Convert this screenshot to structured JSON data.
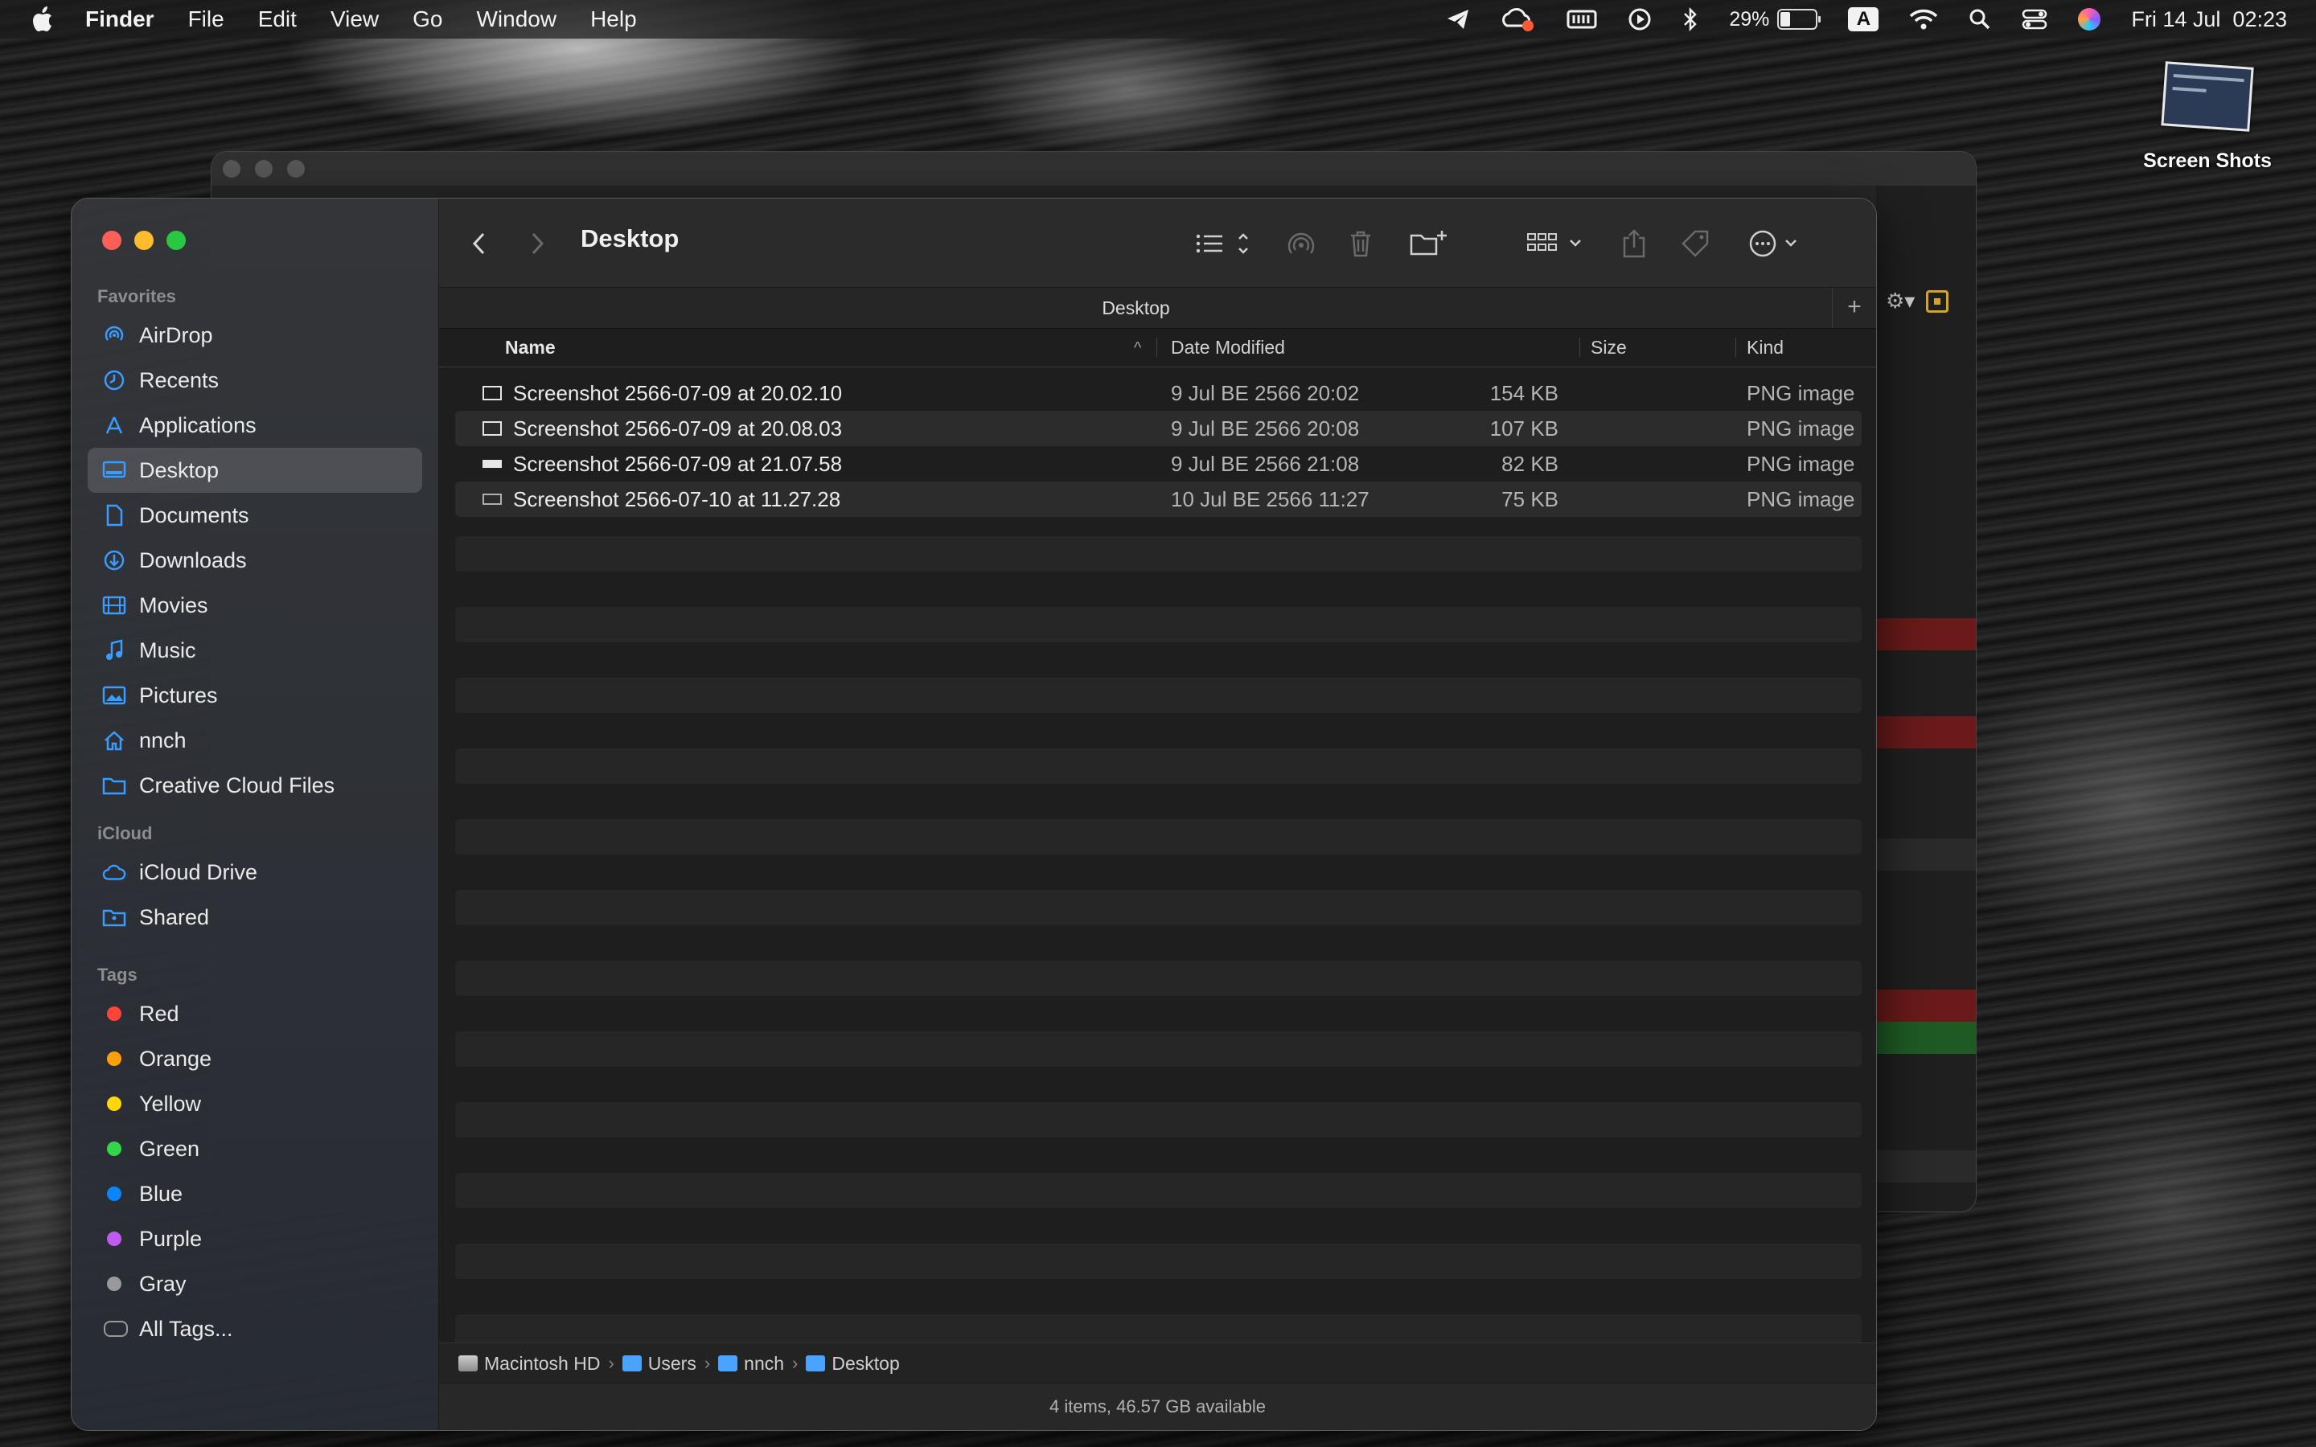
{
  "menubar": {
    "app": "Finder",
    "items": [
      "File",
      "Edit",
      "View",
      "Go",
      "Window",
      "Help"
    ],
    "battery_percent": "29%",
    "input_source": "A",
    "datetime": "Fri 14 Jul  02:23",
    "battery_level": 0.29
  },
  "desktop": {
    "icon_label": "Screen Shots"
  },
  "finder": {
    "title": "Desktop",
    "tab_label": "Desktop",
    "sidebar": {
      "favorites_header": "Favorites",
      "favorites": [
        {
          "label": "AirDrop",
          "icon": "airdrop-icon"
        },
        {
          "label": "Recents",
          "icon": "clock-icon"
        },
        {
          "label": "Applications",
          "icon": "applications-icon"
        },
        {
          "label": "Desktop",
          "icon": "desktop-icon",
          "selected": true
        },
        {
          "label": "Documents",
          "icon": "document-icon"
        },
        {
          "label": "Downloads",
          "icon": "download-icon"
        },
        {
          "label": "Movies",
          "icon": "film-icon"
        },
        {
          "label": "Music",
          "icon": "music-note-icon"
        },
        {
          "label": "Pictures",
          "icon": "photo-icon"
        },
        {
          "label": "nnch",
          "icon": "home-icon"
        },
        {
          "label": "Creative Cloud Files",
          "icon": "folder-icon"
        }
      ],
      "icloud_header": "iCloud",
      "icloud": [
        {
          "label": "iCloud Drive",
          "icon": "cloud-icon"
        },
        {
          "label": "Shared",
          "icon": "shared-folder-icon"
        }
      ],
      "tags_header": "Tags",
      "tags": [
        {
          "label": "Red",
          "color": "#ff453a"
        },
        {
          "label": "Orange",
          "color": "#ff9f0a"
        },
        {
          "label": "Yellow",
          "color": "#ffd60a"
        },
        {
          "label": "Green",
          "color": "#32d74b"
        },
        {
          "label": "Blue",
          "color": "#0a84ff"
        },
        {
          "label": "Purple",
          "color": "#bf5af2"
        },
        {
          "label": "Gray",
          "color": "#98989d"
        },
        {
          "label": "All Tags..."
        }
      ]
    },
    "columns": {
      "name": "Name",
      "date": "Date Modified",
      "size": "Size",
      "kind": "Kind"
    },
    "files": [
      {
        "name": "Screenshot 2566-07-09 at 20.02.10",
        "date": "9 Jul BE 2566 20:02",
        "size": "154 KB",
        "kind": "PNG image"
      },
      {
        "name": "Screenshot 2566-07-09 at 20.08.03",
        "date": "9 Jul BE 2566 20:08",
        "size": "107 KB",
        "kind": "PNG image"
      },
      {
        "name": "Screenshot 2566-07-09 at 21.07.58",
        "date": "9 Jul BE 2566 21:08",
        "size": "82 KB",
        "kind": "PNG image"
      },
      {
        "name": "Screenshot 2566-07-10 at 11.27.28",
        "date": "10 Jul BE 2566 11:27",
        "size": "75 KB",
        "kind": "PNG image"
      }
    ],
    "path": [
      "Macintosh HD",
      "Users",
      "nnch",
      "Desktop"
    ],
    "status": "4 items, 46.57 GB available"
  }
}
